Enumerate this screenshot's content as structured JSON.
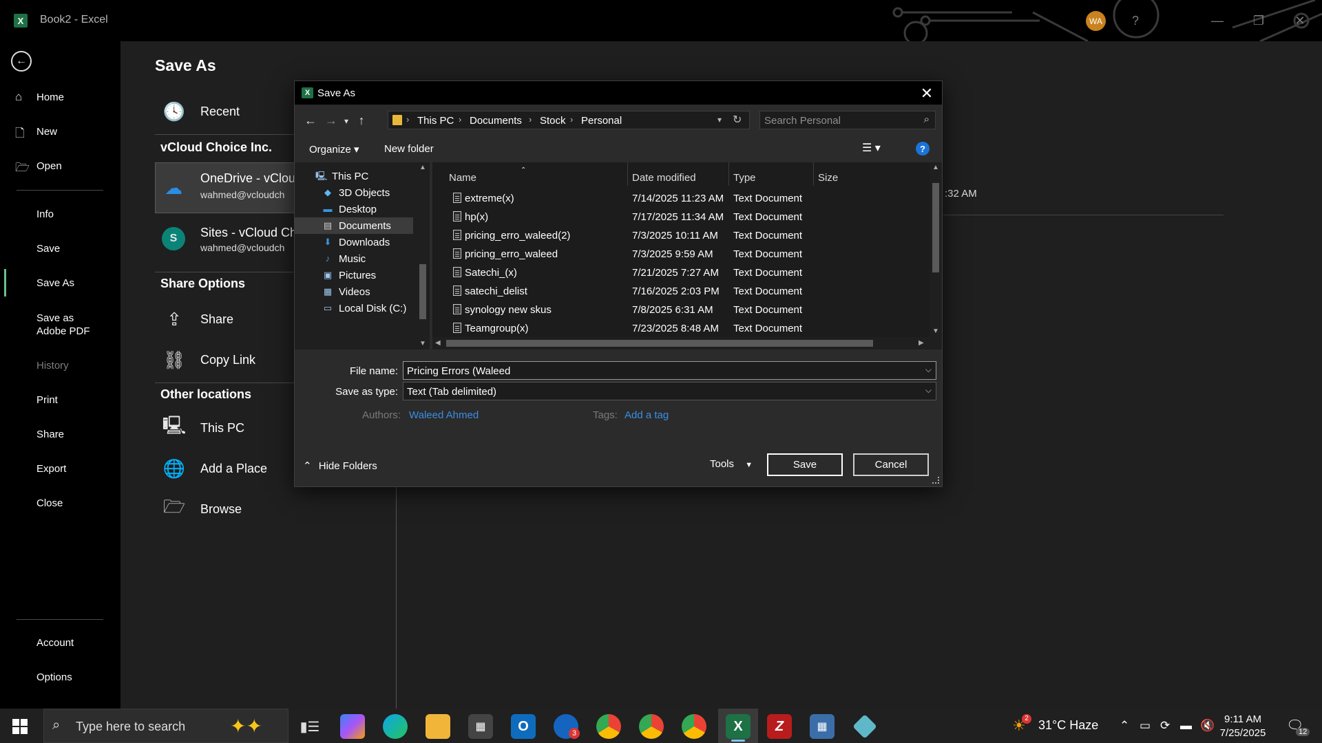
{
  "window": {
    "title": "Book2  -  Excel",
    "app_icon": "X",
    "avatar_initials": "WA",
    "help": "?"
  },
  "backstage": {
    "nav": {
      "back": "←",
      "items": [
        {
          "label": "Home"
        },
        {
          "label": "New"
        },
        {
          "label": "Open"
        },
        {
          "label": "Info"
        },
        {
          "label": "Save"
        },
        {
          "label": "Save As"
        },
        {
          "label": "Save as\nAdobe PDF"
        },
        {
          "label": "History"
        },
        {
          "label": "Print"
        },
        {
          "label": "Share"
        },
        {
          "label": "Export"
        },
        {
          "label": "Close"
        },
        {
          "label": "Account"
        },
        {
          "label": "Options"
        }
      ]
    },
    "page_title": "Save As",
    "recent_label": "Recent",
    "org_heading": "vCloud Choice Inc.",
    "onedrive": {
      "label": "OneDrive - vCloud",
      "sub": "wahmed@vcloudch"
    },
    "sites": {
      "label": "Sites - vCloud Ch",
      "sub": "wahmed@vcloudch"
    },
    "share_heading": "Share Options",
    "share_label": "Share",
    "copy_link_label": "Copy Link",
    "other_heading": "Other locations",
    "this_pc_label": "This PC",
    "add_place_label": "Add a Place",
    "browse_label": "Browse",
    "recent_time_partial": ":32 AM"
  },
  "dialog": {
    "title": "Save As",
    "close": "✕",
    "path": [
      "This PC",
      "Documents",
      "Stock",
      "Personal"
    ],
    "search_placeholder": "Search Personal",
    "organize": "Organize ▾",
    "new_folder": "New folder",
    "help": "?",
    "tree": [
      {
        "label": "This PC",
        "icon": "computer-icon"
      },
      {
        "label": "3D Objects",
        "icon": "cube-icon"
      },
      {
        "label": "Desktop",
        "icon": "desktop-icon"
      },
      {
        "label": "Documents",
        "icon": "documents-icon",
        "selected": true
      },
      {
        "label": "Downloads",
        "icon": "download-icon"
      },
      {
        "label": "Music",
        "icon": "music-icon"
      },
      {
        "label": "Pictures",
        "icon": "pictures-icon"
      },
      {
        "label": "Videos",
        "icon": "videos-icon"
      },
      {
        "label": "Local Disk (C:)",
        "icon": "disk-icon"
      }
    ],
    "columns": [
      "Name",
      "Date modified",
      "Type",
      "Size"
    ],
    "files": [
      {
        "name": "extreme(x)",
        "date": "7/14/2025 11:23 AM",
        "type": "Text Document"
      },
      {
        "name": "hp(x)",
        "date": "7/17/2025 11:34 AM",
        "type": "Text Document"
      },
      {
        "name": "pricing_erro_waleed(2)",
        "date": "7/3/2025 10:11 AM",
        "type": "Text Document"
      },
      {
        "name": "pricing_erro_waleed",
        "date": "7/3/2025 9:59 AM",
        "type": "Text Document"
      },
      {
        "name": "Satechi_(x)",
        "date": "7/21/2025 7:27 AM",
        "type": "Text Document"
      },
      {
        "name": "satechi_delist",
        "date": "7/16/2025 2:03 PM",
        "type": "Text Document"
      },
      {
        "name": "synology new skus",
        "date": "7/8/2025 6:31 AM",
        "type": "Text Document"
      },
      {
        "name": "Teamgroup(x)",
        "date": "7/23/2025 8:48 AM",
        "type": "Text Document"
      }
    ],
    "file_name_label": "File name:",
    "file_name_value": "Pricing Errors (Waleed",
    "save_type_label": "Save as type:",
    "save_type_value": "Text (Tab delimited)",
    "authors_label": "Authors:",
    "authors_value": "Waleed Ahmed",
    "tags_label": "Tags:",
    "tags_value": "Add a tag",
    "hide_folders": "Hide Folders",
    "tools": "Tools",
    "save": "Save",
    "cancel": "Cancel"
  },
  "taskbar": {
    "search_placeholder": "Type here to search",
    "weather": "31°C  Haze",
    "time": "9:11 AM",
    "date": "7/25/2025",
    "notification_count": "12",
    "outlook_badge": "3",
    "weather_badge": "2"
  },
  "colors": {
    "excel_green": "#1e7145",
    "link_blue": "#3a8ee6",
    "accent_bar": "#6bbf8e"
  }
}
